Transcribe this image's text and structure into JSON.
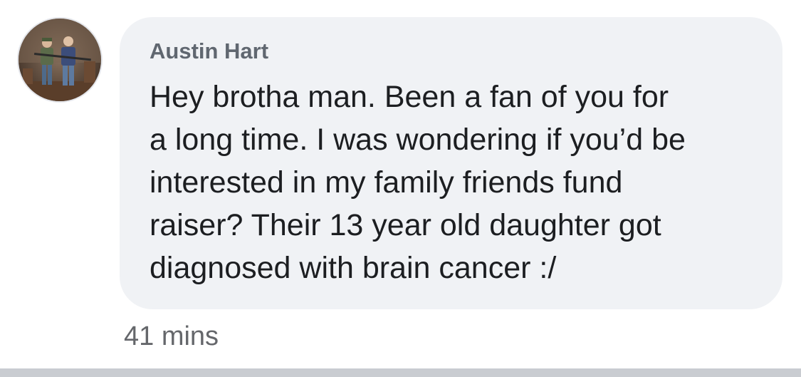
{
  "comment": {
    "author": "Austin Hart",
    "message": "Hey brotha man. Been a fan of you for\na long time. I was wondering if you’d be\ninterested in my family friends fund\nraiser? Their 13 year old daughter got\ndiagnosed with brain cancer :/",
    "timestamp": "41 mins"
  },
  "colors": {
    "bubble": "#f0f2f5",
    "author_text": "#606770",
    "message_text": "#1c1e21",
    "timestamp_text": "#65676b",
    "divider": "#c9ccd1"
  }
}
